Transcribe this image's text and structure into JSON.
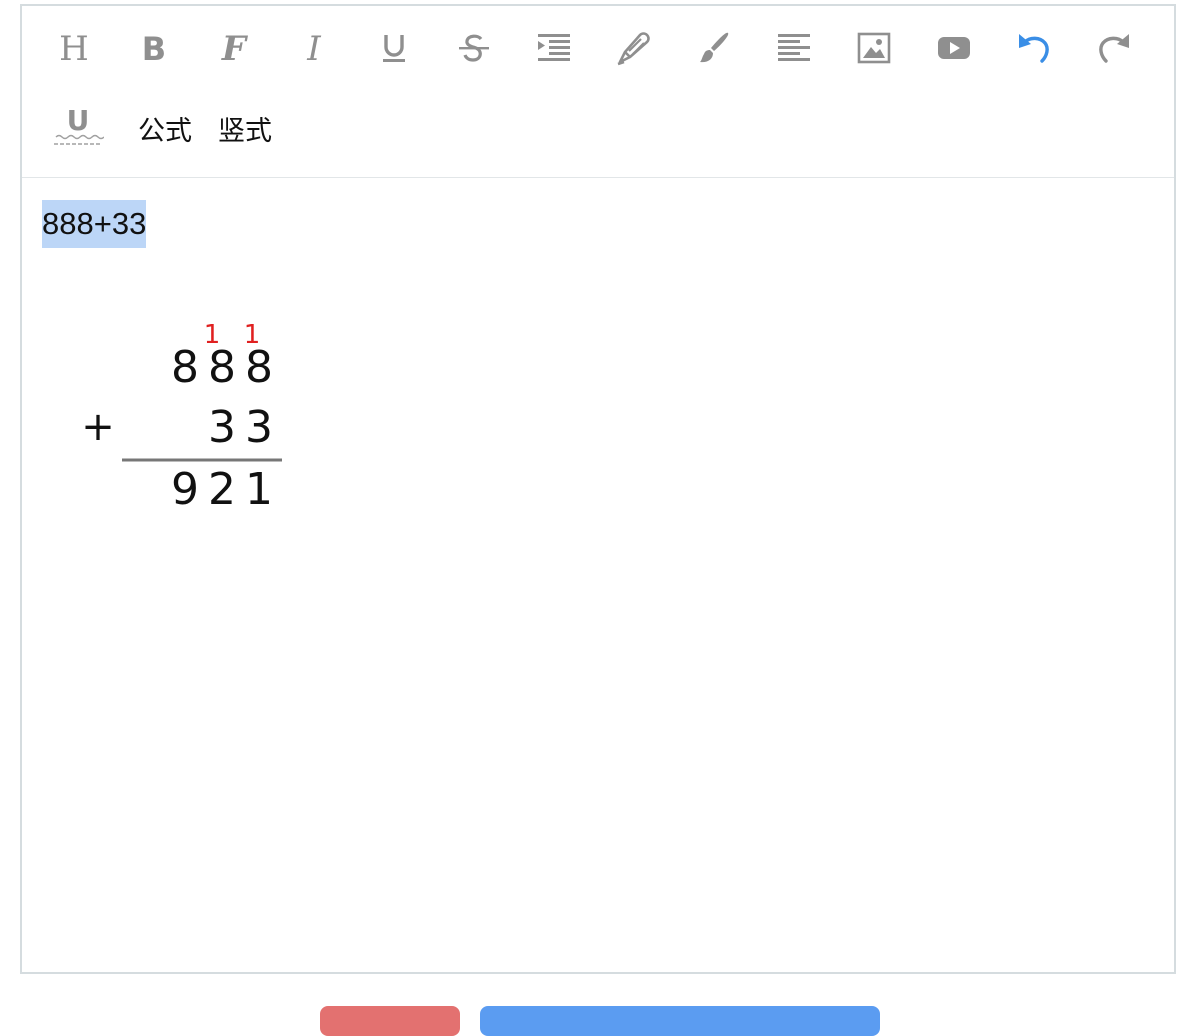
{
  "toolbar": {
    "icon_color": "#8f8f8f",
    "undo_color": "#3a8ee6",
    "row1": [
      {
        "name": "heading-icon",
        "title": "H"
      },
      {
        "name": "bold-icon",
        "title": "B"
      },
      {
        "name": "font-icon",
        "title": "F"
      },
      {
        "name": "italic-icon",
        "title": "I"
      },
      {
        "name": "underline-icon"
      },
      {
        "name": "strikethrough-icon"
      },
      {
        "name": "indent-icon"
      },
      {
        "name": "highlighter-icon"
      },
      {
        "name": "paintbrush-icon"
      },
      {
        "name": "align-icon"
      },
      {
        "name": "image-icon"
      },
      {
        "name": "video-icon"
      },
      {
        "name": "undo-icon"
      },
      {
        "name": "redo-icon"
      }
    ],
    "wavy_underline_label": "U",
    "formula_label": "公式",
    "vertical_label": "竖式"
  },
  "content": {
    "selected_text": "888+33",
    "vertical_calc": {
      "operator": "+",
      "top_number": "888",
      "bottom_number": "33",
      "result": "921",
      "carry_marks": [
        "1",
        "1"
      ],
      "carry_color": "#e02020"
    }
  },
  "colors": {
    "selection": "#bcd6f7",
    "border": "#d5dcdf",
    "button_red": "#e37170",
    "button_blue": "#5b9cf1"
  }
}
